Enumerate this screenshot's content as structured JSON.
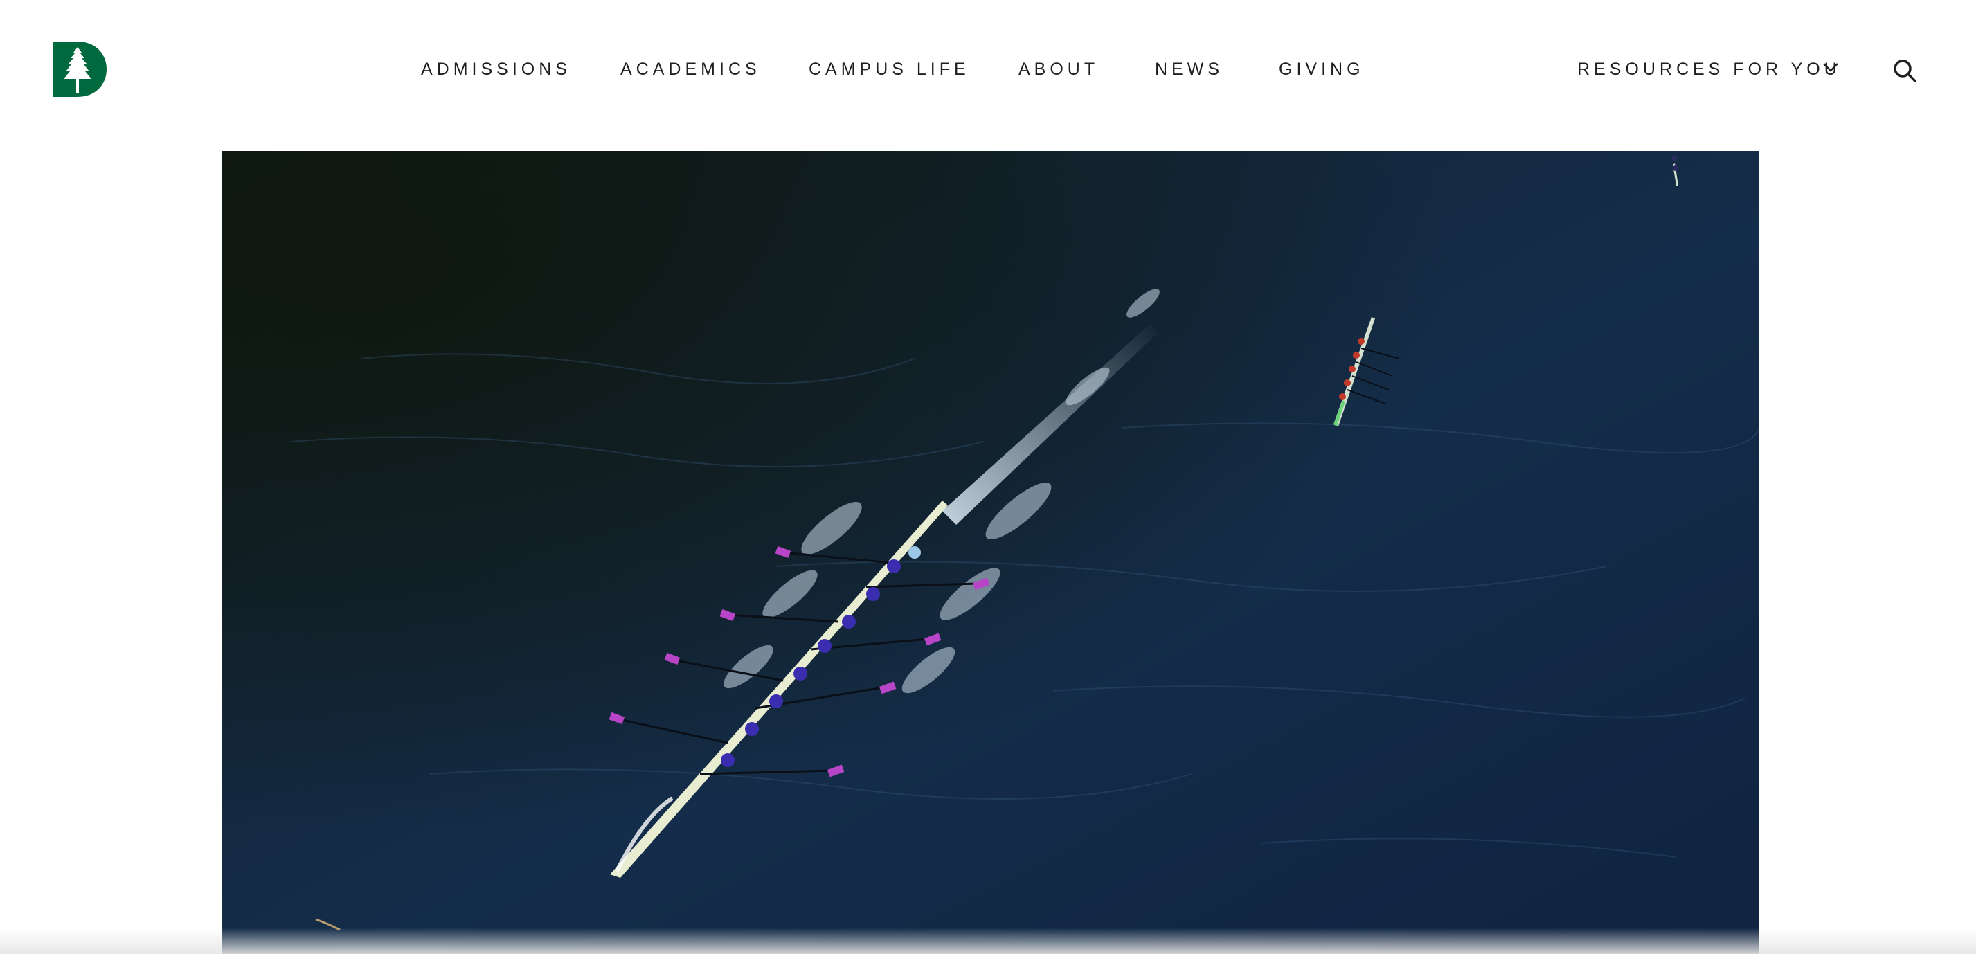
{
  "header": {
    "logo_icon": "dartmouth-pine-d-logo",
    "brand_color": "#00693e",
    "nav": [
      {
        "label": "ADMISSIONS"
      },
      {
        "label": "ACADEMICS"
      },
      {
        "label": "CAMPUS LIFE"
      },
      {
        "label": "ABOUT"
      },
      {
        "label": "NEWS"
      },
      {
        "label": "GIVING"
      }
    ],
    "resources_label": "RESOURCES FOR YOU",
    "chevron_icon": "chevron-down-icon",
    "search_icon": "search-icon"
  },
  "hero": {
    "image_subject": "aerial-rowing-on-river",
    "water_color": "#122a46",
    "shade_color": "#0f1810",
    "oar_color": "#b844c7"
  }
}
